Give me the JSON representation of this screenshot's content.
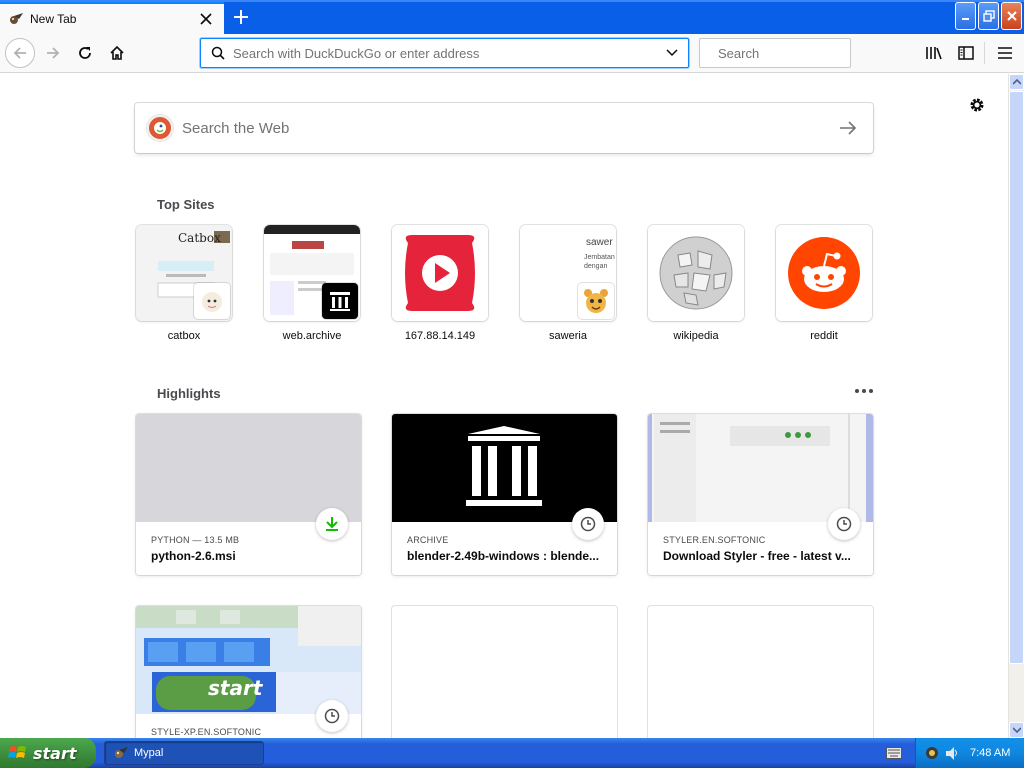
{
  "window": {
    "tab_title": "New Tab",
    "tab_favicon": "mypal-icon",
    "colors": {
      "titlebar": "#0a5fe8",
      "accent": "#0a84ff"
    }
  },
  "toolbar": {
    "address_placeholder": "Search with DuckDuckGo or enter address",
    "search_placeholder": "Search"
  },
  "newtab": {
    "web_search_placeholder": "Search the Web",
    "top_sites_title": "Top Sites",
    "highlights_title": "Highlights",
    "top_sites": [
      {
        "label": "catbox",
        "preview_text": "Catbox"
      },
      {
        "label": "web.archive"
      },
      {
        "label": "167.88.14.149"
      },
      {
        "label": "saweria",
        "preview_text": "sawer",
        "preview_sub": "Jembatan dengan pe"
      },
      {
        "label": "wikipedia"
      },
      {
        "label": "reddit"
      }
    ],
    "highlights": [
      {
        "context": "PYTHON — 13.5 MB",
        "title": "python-2.6.msi",
        "badge": "download-icon"
      },
      {
        "context": "ARCHIVE",
        "title": "blender-2.49b-windows : blende...",
        "badge": "clock-icon"
      },
      {
        "context": "STYLER.EN.SOFTONIC",
        "title": "Download Styler - free - latest v...",
        "badge": "clock-icon"
      },
      {
        "context": "STYLE-XP.EN.SOFTONIC",
        "title": "",
        "badge": "clock-icon",
        "preview_text": "start"
      },
      {
        "context": "",
        "title": ""
      },
      {
        "context": "",
        "title": ""
      }
    ]
  },
  "taskbar": {
    "start_label": "start",
    "task_label": "Mypal",
    "clock": "7:48 AM"
  }
}
